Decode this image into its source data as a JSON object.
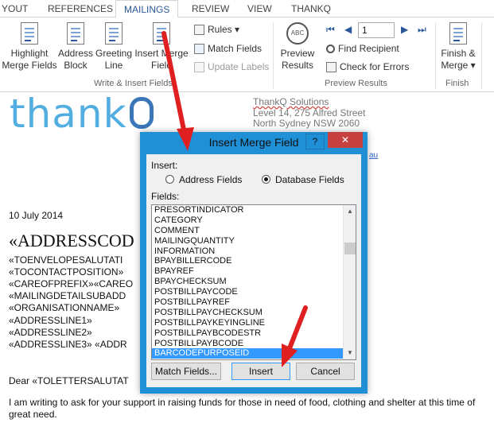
{
  "ribbon": {
    "tabs": [
      "YOUT",
      "REFERENCES",
      "MAILINGS",
      "REVIEW",
      "VIEW",
      "THANKQ"
    ],
    "active_tab": "MAILINGS",
    "buttons": {
      "highlight": [
        "Highlight",
        "Merge Fields"
      ],
      "address_block": [
        "Address",
        "Block"
      ],
      "greeting_line": [
        "Greeting",
        "Line"
      ],
      "insert_merge": [
        "Insert Merge",
        "Field"
      ],
      "preview": [
        "Preview",
        "Results"
      ],
      "finish": [
        "Finish &",
        "Merge"
      ]
    },
    "small": {
      "rules": "Rules",
      "match_fields": "Match Fields",
      "update_labels": "Update Labels",
      "find_recipient": "Find Recipient",
      "check_errors": "Check for Errors"
    },
    "record_number": "1",
    "groups": {
      "write_insert": "Write & Insert Fields",
      "preview_results": "Preview Results",
      "finish": "Finish"
    }
  },
  "document": {
    "logo": "thank",
    "address": [
      "ThankQ Solutions",
      "Level 14, 275 Alfred Street",
      "North Sydney NSW 2060"
    ],
    "link_fragment": "au",
    "date": "10 July 2014",
    "big_field": "«ADDRESSCOD",
    "fields": [
      "«TOENVELOPESALUTATI",
      "«TOCONTACTPOSITION»",
      "«CAREOFPREFIX»«CAREO",
      "«MAILINGDETAILSUBADD",
      "«ORGANISATIONNAME»",
      "«ADDRESSLINE1»",
      "«ADDRESSLINE2»",
      "«ADDRESSLINE3» «ADDR"
    ],
    "dear": "Dear «TOLETTERSALUTAT",
    "body": "I am writing to ask for your support in raising funds for those in need of food, clothing and shelter at this time of great need."
  },
  "dialog": {
    "title": "Insert Merge Field",
    "help": "?",
    "close": "✕",
    "insert_label": "Insert:",
    "radio_address": "Address Fields",
    "radio_database": "Database Fields",
    "fields_label": "Fields:",
    "items": [
      "PRESORTINDICATOR",
      "CATEGORY",
      "COMMENT",
      "MAILINGQUANTITY",
      "INFORMATION",
      "BPAYBILLERCODE",
      "BPAYREF",
      "BPAYCHECKSUM",
      "POSTBILLPAYCODE",
      "POSTBILLPAYREF",
      "POSTBILLPAYCHECKSUM",
      "POSTBILLPAYKEYINGLINE",
      "POSTBILLPAYBCODESTR",
      "POSTBILLPAYBCODE",
      "BARCODEPURPOSEID"
    ],
    "selected_item": "BARCODEPURPOSEID",
    "buttons": {
      "match": "Match Fields...",
      "insert": "Insert",
      "cancel": "Cancel"
    },
    "colors": {
      "title_bar": "#1f8fd6",
      "selection": "#3399ff",
      "close": "#c74040"
    }
  },
  "annotations": {
    "arrow_color": "#e02020"
  }
}
